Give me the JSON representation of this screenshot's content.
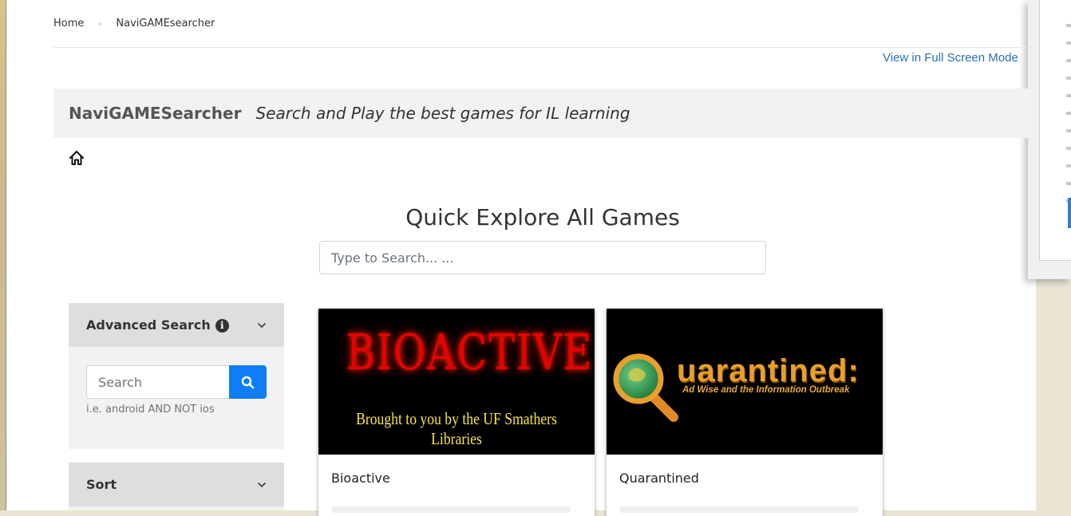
{
  "breadcrumb": {
    "home": "Home",
    "current": "NaviGAMEsearcher"
  },
  "fullscreen_link": "View in Full Screen Mode",
  "header": {
    "brand": "NaviGAMESearcher",
    "tagline": "Search and Play the best games for IL learning"
  },
  "icons": {
    "home": "home-icon",
    "info": "info-icon",
    "search": "search-icon",
    "chevron": "chevron-down-icon"
  },
  "main": {
    "heading": "Quick Explore All Games",
    "search_placeholder": "Type to Search... ..."
  },
  "sidebar": {
    "advanced_search": {
      "title": "Advanced Search",
      "info_glyph": "i",
      "input_placeholder": "Search",
      "hint": "i.e. android AND NOT ios"
    },
    "sort": {
      "title": "Sort"
    }
  },
  "cards": [
    {
      "title": "Bioactive",
      "image_text": {
        "title": "BIOACTIVE",
        "subtitle": "Brought to you by the UF Smathers Libraries"
      }
    },
    {
      "title": "Quarantined",
      "image_text": {
        "title": "uarantined:",
        "subtitle": "Ad Wise and the Information Outbreak"
      }
    }
  ],
  "colors": {
    "link": "#2a6fb5",
    "search_button": "#0d7ef5",
    "panel_header": "#dedede",
    "panel_body": "#f2f2f2",
    "title_bar": "#f2f2f2"
  }
}
